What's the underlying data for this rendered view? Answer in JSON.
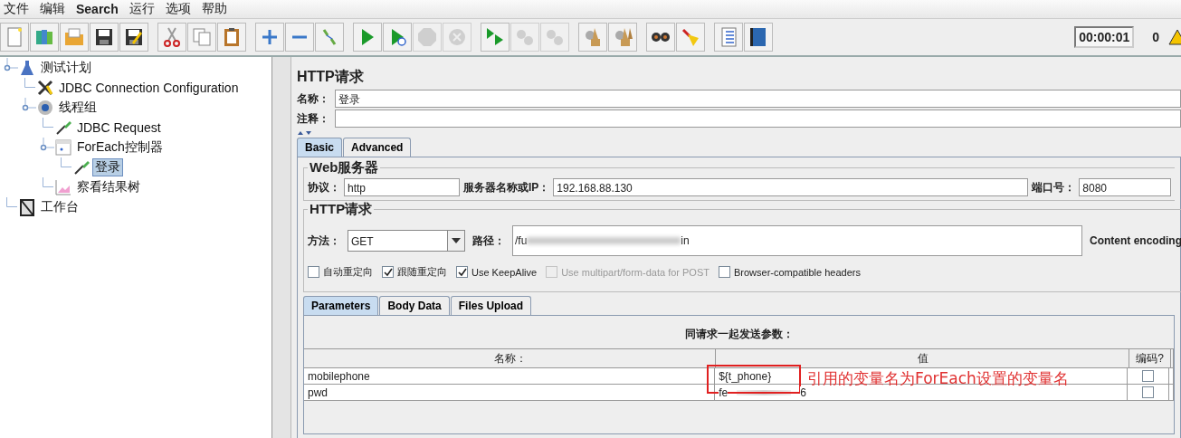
{
  "menu": [
    "文件",
    "编辑",
    "Search",
    "运行",
    "选项",
    "帮助"
  ],
  "toolbar": {
    "groups": [
      [
        {
          "kind": "new",
          "disabled": false
        },
        {
          "kind": "templates",
          "disabled": false
        },
        {
          "kind": "open",
          "disabled": false
        },
        {
          "kind": "save",
          "disabled": false
        },
        {
          "kind": "save-as",
          "disabled": false
        }
      ],
      [
        {
          "kind": "cut",
          "disabled": false
        },
        {
          "kind": "copy",
          "disabled": false
        },
        {
          "kind": "paste",
          "disabled": false
        }
      ],
      [
        {
          "kind": "expand",
          "disabled": false
        },
        {
          "kind": "collapse",
          "disabled": false
        },
        {
          "kind": "toggle",
          "disabled": false
        }
      ],
      [
        {
          "kind": "start",
          "disabled": false
        },
        {
          "kind": "start-no-timers",
          "disabled": false
        },
        {
          "kind": "stop",
          "disabled": true
        },
        {
          "kind": "shutdown",
          "disabled": true
        }
      ],
      [
        {
          "kind": "remote-start",
          "disabled": false
        },
        {
          "kind": "remote-stop",
          "disabled": true
        },
        {
          "kind": "remote-exit",
          "disabled": true
        }
      ],
      [
        {
          "kind": "clear",
          "disabled": false
        },
        {
          "kind": "clear-all",
          "disabled": false
        }
      ],
      [
        {
          "kind": "search",
          "disabled": false
        },
        {
          "kind": "reset-search",
          "disabled": false
        }
      ],
      [
        {
          "kind": "functions",
          "disabled": false
        },
        {
          "kind": "help",
          "disabled": false
        }
      ]
    ],
    "timer": "00:00:01",
    "warning_count": "0"
  },
  "tree": [
    {
      "label": "测试计划",
      "kind": "plan",
      "selected": false,
      "children": [
        {
          "label": "JDBC Connection Configuration",
          "kind": "config",
          "selected": false
        },
        {
          "label": "线程组",
          "kind": "threads",
          "selected": false,
          "children": [
            {
              "label": "JDBC Request",
              "kind": "sampler",
              "selected": false
            },
            {
              "label": "ForEach控制器",
              "kind": "controller",
              "selected": false,
              "children": [
                {
                  "label": "登录",
                  "kind": "sampler",
                  "selected": true
                }
              ]
            },
            {
              "label": "察看结果树",
              "kind": "listener",
              "selected": false
            }
          ]
        }
      ]
    },
    {
      "label": "工作台",
      "kind": "workbench",
      "selected": false
    }
  ],
  "editor": {
    "title": "HTTP请求",
    "name_label": "名称：",
    "name": "登录",
    "comment_label": "注释：",
    "tabs": [
      {
        "label": "Basic",
        "selected": true
      },
      {
        "label": "Advanced",
        "selected": false
      }
    ],
    "web_server": {
      "legend": "Web服务器",
      "protocol_label": "协议：",
      "protocol": "http",
      "server_label": "服务器名称或IP：",
      "server": "192.168.88.130",
      "port_label": "端口号：",
      "port": "8080"
    },
    "http_request": {
      "legend": "HTTP请求",
      "method_label": "方法：",
      "method": "GET",
      "path_label": "路径：",
      "path_parts": [
        "/fu",
        "in"
      ],
      "content_encoding_label": "Content encoding",
      "options": [
        {
          "label": "自动重定向",
          "checked": false,
          "disabled": false
        },
        {
          "label": "跟随重定向",
          "checked": true,
          "disabled": false
        },
        {
          "label": "Use KeepAlive",
          "checked": true,
          "disabled": false
        },
        {
          "label": "Use multipart/form-data for POST",
          "checked": false,
          "disabled": true
        },
        {
          "label": "Browser-compatible headers",
          "checked": false,
          "disabled": false
        }
      ]
    },
    "param_tabs": [
      {
        "label": "Parameters",
        "selected": true
      },
      {
        "label": "Body Data",
        "selected": false
      },
      {
        "label": "Files Upload",
        "selected": false
      }
    ],
    "parameters": {
      "caption": "同请求一起发送参数：",
      "columns": [
        "名称：",
        "值",
        "编码?"
      ],
      "rows": [
        {
          "name": "mobilephone",
          "value_parts": [
            "${t_phone}"
          ],
          "encode": false
        },
        {
          "name": "pwd",
          "value_parts": [
            "fe",
            "6"
          ],
          "encode": false
        }
      ]
    }
  },
  "annotation": {
    "text": "引用的变量名为ForEach设置的变量名"
  }
}
